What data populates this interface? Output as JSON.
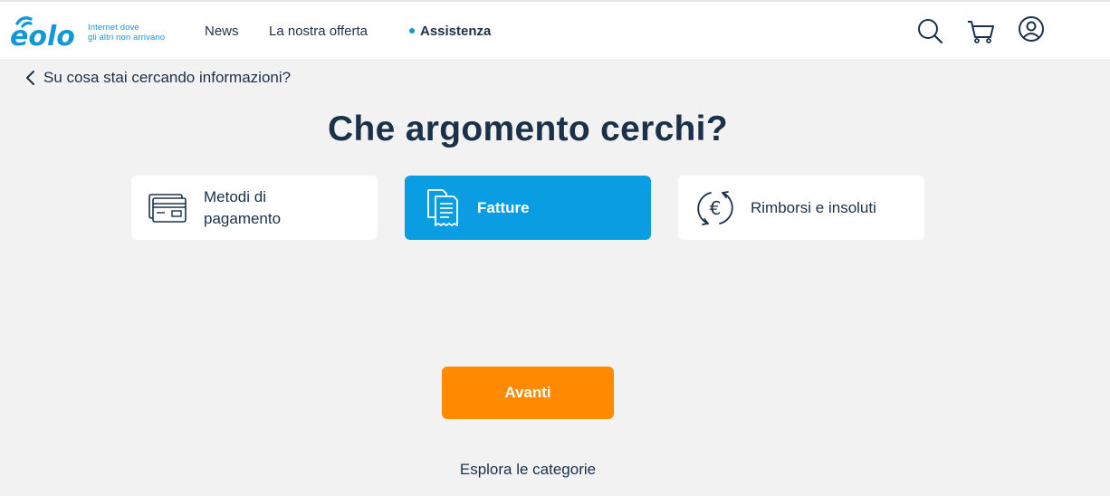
{
  "brand": {
    "logo_text": "eolo",
    "tagline_line1": "Internet dove",
    "tagline_line2": "gli altri non arrivano",
    "color": "#1596d6"
  },
  "nav": {
    "news": "News",
    "offer": "La nostra offerta",
    "support": "Assistenza"
  },
  "header_icons": [
    "search-icon",
    "cart-icon",
    "user-icon"
  ],
  "back_link": "Su cosa stai cercando informazioni?",
  "title": "Che argomento cerchi?",
  "topics": [
    {
      "label": "Metodi di pagamento",
      "icon": "credit-card-icon",
      "selected": false
    },
    {
      "label": "Fatture",
      "icon": "invoice-icon",
      "selected": true
    },
    {
      "label": "Rimborsi e insoluti",
      "icon": "euro-refresh-icon",
      "selected": false
    }
  ],
  "next_button": "Avanti",
  "explore_link": "Esplora le categorie",
  "colors": {
    "accent_blue": "#0a9de2",
    "cta_orange": "#ff8a00",
    "text_dark": "#1b3149",
    "background": "#f2f2f2"
  }
}
